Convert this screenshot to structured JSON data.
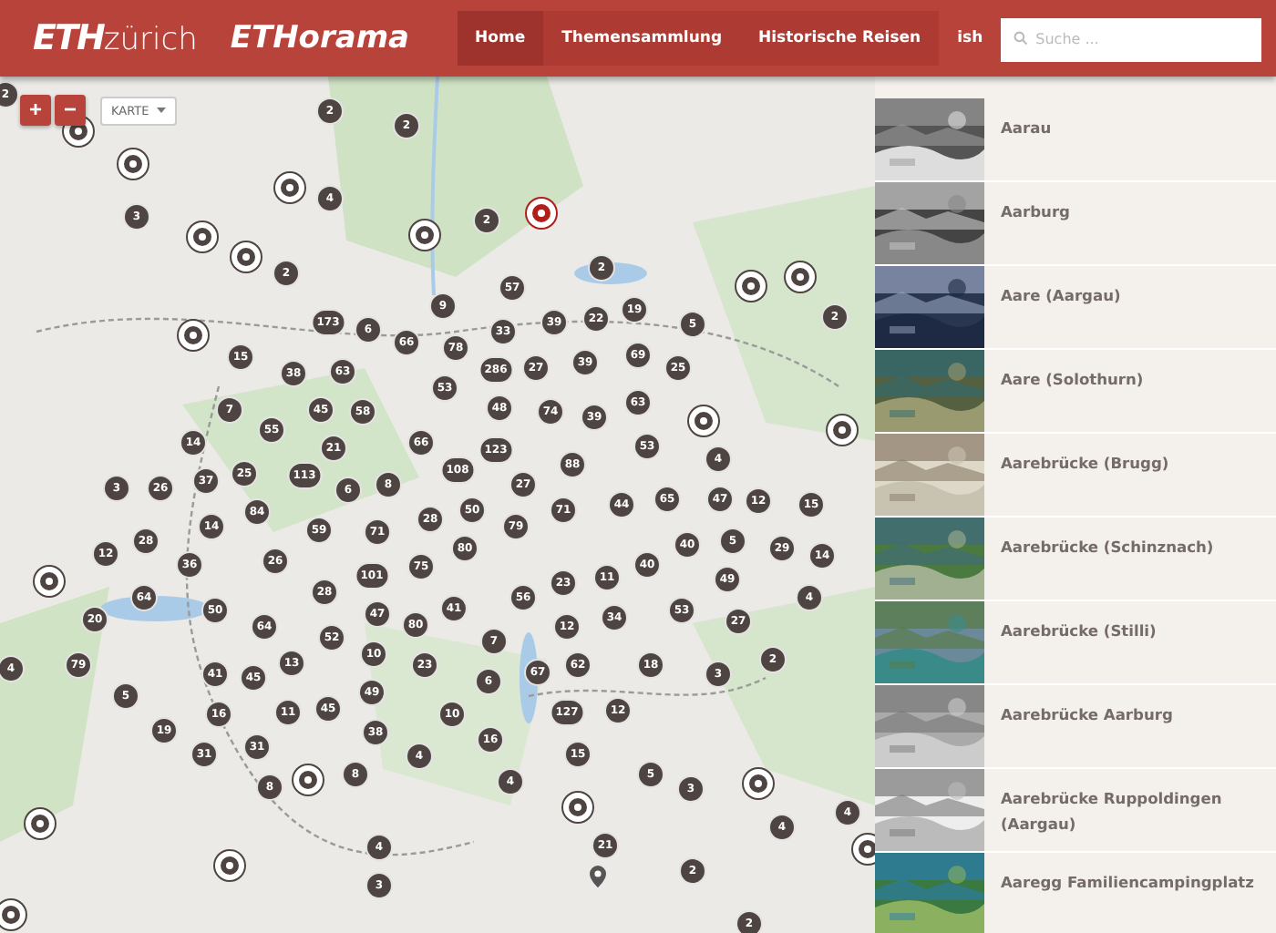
{
  "header": {
    "logo": {
      "brand": "ETH",
      "name": "zürich"
    },
    "app_name": "ETHorama",
    "nav": [
      {
        "label": "Home",
        "selected": true
      },
      {
        "label": "Themensammlung",
        "selected": false
      },
      {
        "label": "Historische Reisen",
        "selected": false
      },
      {
        "label": "ish",
        "selected": false
      }
    ],
    "search": {
      "placeholder": "Suche ..."
    }
  },
  "map": {
    "zoom_in": "+",
    "zoom_out": "−",
    "layer_select": "KARTE",
    "markers": [
      {
        "kind": "cluster",
        "count": "2"
      },
      {
        "kind": "cluster",
        "count": "2"
      },
      {
        "kind": "single",
        "selected": false
      },
      {
        "kind": "cluster",
        "count": "2"
      },
      {
        "kind": "single",
        "selected": false
      },
      {
        "kind": "single",
        "selected": false
      },
      {
        "kind": "cluster",
        "count": "4"
      },
      {
        "kind": "cluster",
        "count": "3"
      },
      {
        "kind": "cluster",
        "count": "2"
      },
      {
        "kind": "single",
        "selected": true
      },
      {
        "kind": "single",
        "selected": false
      },
      {
        "kind": "single",
        "selected": false
      },
      {
        "kind": "single",
        "selected": false
      },
      {
        "kind": "cluster",
        "count": "2"
      },
      {
        "kind": "cluster",
        "count": "57"
      },
      {
        "kind": "cluster",
        "count": "2"
      },
      {
        "kind": "single",
        "selected": false
      },
      {
        "kind": "single",
        "selected": false
      },
      {
        "kind": "single",
        "selected": false
      },
      {
        "kind": "cluster",
        "count": "173"
      },
      {
        "kind": "cluster",
        "count": "6"
      },
      {
        "kind": "cluster",
        "count": "9"
      },
      {
        "kind": "cluster",
        "count": "33"
      },
      {
        "kind": "cluster",
        "count": "39"
      },
      {
        "kind": "cluster",
        "count": "22"
      },
      {
        "kind": "cluster",
        "count": "19"
      },
      {
        "kind": "cluster",
        "count": "5"
      },
      {
        "kind": "cluster",
        "count": "2"
      },
      {
        "kind": "cluster",
        "count": "15"
      },
      {
        "kind": "cluster",
        "count": "66"
      },
      {
        "kind": "cluster",
        "count": "78"
      },
      {
        "kind": "cluster",
        "count": "69"
      },
      {
        "kind": "cluster",
        "count": "38"
      },
      {
        "kind": "cluster",
        "count": "63"
      },
      {
        "kind": "cluster",
        "count": "286"
      },
      {
        "kind": "cluster",
        "count": "27"
      },
      {
        "kind": "cluster",
        "count": "39"
      },
      {
        "kind": "cluster",
        "count": "25"
      },
      {
        "kind": "cluster",
        "count": "53"
      },
      {
        "kind": "cluster",
        "count": "7"
      },
      {
        "kind": "cluster",
        "count": "55"
      },
      {
        "kind": "cluster",
        "count": "45"
      },
      {
        "kind": "cluster",
        "count": "58"
      },
      {
        "kind": "cluster",
        "count": "48"
      },
      {
        "kind": "cluster",
        "count": "74"
      },
      {
        "kind": "cluster",
        "count": "39"
      },
      {
        "kind": "cluster",
        "count": "63"
      },
      {
        "kind": "single",
        "selected": false
      },
      {
        "kind": "cluster",
        "count": "14"
      },
      {
        "kind": "cluster",
        "count": "21"
      },
      {
        "kind": "cluster",
        "count": "66"
      },
      {
        "kind": "cluster",
        "count": "123"
      },
      {
        "kind": "cluster",
        "count": "53"
      },
      {
        "kind": "single",
        "selected": false
      },
      {
        "kind": "cluster",
        "count": "3"
      },
      {
        "kind": "cluster",
        "count": "26"
      },
      {
        "kind": "cluster",
        "count": "37"
      },
      {
        "kind": "cluster",
        "count": "25"
      },
      {
        "kind": "cluster",
        "count": "113"
      },
      {
        "kind": "cluster",
        "count": "6"
      },
      {
        "kind": "cluster",
        "count": "8"
      },
      {
        "kind": "cluster",
        "count": "108"
      },
      {
        "kind": "cluster",
        "count": "27"
      },
      {
        "kind": "cluster",
        "count": "88"
      },
      {
        "kind": "cluster",
        "count": "4"
      },
      {
        "kind": "cluster",
        "count": "84"
      },
      {
        "kind": "cluster",
        "count": "50"
      },
      {
        "kind": "cluster",
        "count": "71"
      },
      {
        "kind": "cluster",
        "count": "44"
      },
      {
        "kind": "cluster",
        "count": "65"
      },
      {
        "kind": "cluster",
        "count": "47"
      },
      {
        "kind": "cluster",
        "count": "12"
      },
      {
        "kind": "cluster",
        "count": "15"
      },
      {
        "kind": "cluster",
        "count": "14"
      },
      {
        "kind": "cluster",
        "count": "59"
      },
      {
        "kind": "cluster",
        "count": "71"
      },
      {
        "kind": "cluster",
        "count": "28"
      },
      {
        "kind": "cluster",
        "count": "79"
      },
      {
        "kind": "cluster",
        "count": "12"
      },
      {
        "kind": "cluster",
        "count": "28"
      },
      {
        "kind": "cluster",
        "count": "36"
      },
      {
        "kind": "cluster",
        "count": "26"
      },
      {
        "kind": "cluster",
        "count": "75"
      },
      {
        "kind": "cluster",
        "count": "80"
      },
      {
        "kind": "cluster",
        "count": "40"
      },
      {
        "kind": "cluster",
        "count": "40"
      },
      {
        "kind": "cluster",
        "count": "5"
      },
      {
        "kind": "cluster",
        "count": "29"
      },
      {
        "kind": "cluster",
        "count": "14"
      },
      {
        "kind": "single",
        "selected": false
      },
      {
        "kind": "cluster",
        "count": "101"
      },
      {
        "kind": "cluster",
        "count": "23"
      },
      {
        "kind": "cluster",
        "count": "11"
      },
      {
        "kind": "cluster",
        "count": "49"
      },
      {
        "kind": "cluster",
        "count": "64"
      },
      {
        "kind": "cluster",
        "count": "28"
      },
      {
        "kind": "cluster",
        "count": "56"
      },
      {
        "kind": "cluster",
        "count": "4"
      },
      {
        "kind": "cluster",
        "count": "20"
      },
      {
        "kind": "cluster",
        "count": "50"
      },
      {
        "kind": "cluster",
        "count": "64"
      },
      {
        "kind": "cluster",
        "count": "47"
      },
      {
        "kind": "cluster",
        "count": "80"
      },
      {
        "kind": "cluster",
        "count": "41"
      },
      {
        "kind": "cluster",
        "count": "12"
      },
      {
        "kind": "cluster",
        "count": "34"
      },
      {
        "kind": "cluster",
        "count": "53"
      },
      {
        "kind": "cluster",
        "count": "27"
      },
      {
        "kind": "cluster",
        "count": "52"
      },
      {
        "kind": "cluster",
        "count": "7"
      },
      {
        "kind": "cluster",
        "count": "4"
      },
      {
        "kind": "cluster",
        "count": "79"
      },
      {
        "kind": "cluster",
        "count": "41"
      },
      {
        "kind": "cluster",
        "count": "45"
      },
      {
        "kind": "cluster",
        "count": "13"
      },
      {
        "kind": "cluster",
        "count": "10"
      },
      {
        "kind": "cluster",
        "count": "23"
      },
      {
        "kind": "cluster",
        "count": "6"
      },
      {
        "kind": "cluster",
        "count": "67"
      },
      {
        "kind": "cluster",
        "count": "62"
      },
      {
        "kind": "cluster",
        "count": "18"
      },
      {
        "kind": "cluster",
        "count": "3"
      },
      {
        "kind": "cluster",
        "count": "2"
      },
      {
        "kind": "cluster",
        "count": "5"
      },
      {
        "kind": "cluster",
        "count": "49"
      },
      {
        "kind": "cluster",
        "count": "16"
      },
      {
        "kind": "cluster",
        "count": "11"
      },
      {
        "kind": "cluster",
        "count": "45"
      },
      {
        "kind": "cluster",
        "count": "10"
      },
      {
        "kind": "cluster",
        "count": "127"
      },
      {
        "kind": "cluster",
        "count": "12"
      },
      {
        "kind": "cluster",
        "count": "19"
      },
      {
        "kind": "cluster",
        "count": "38"
      },
      {
        "kind": "cluster",
        "count": "16"
      },
      {
        "kind": "cluster",
        "count": "31"
      },
      {
        "kind": "cluster",
        "count": "31"
      },
      {
        "kind": "cluster",
        "count": "4"
      },
      {
        "kind": "cluster",
        "count": "15"
      },
      {
        "kind": "cluster",
        "count": "8"
      },
      {
        "kind": "single",
        "selected": false
      },
      {
        "kind": "cluster",
        "count": "8"
      },
      {
        "kind": "cluster",
        "count": "4"
      },
      {
        "kind": "cluster",
        "count": "5"
      },
      {
        "kind": "cluster",
        "count": "3"
      },
      {
        "kind": "single",
        "selected": false
      },
      {
        "kind": "single",
        "selected": false
      },
      {
        "kind": "single",
        "selected": false
      },
      {
        "kind": "cluster",
        "count": "4"
      },
      {
        "kind": "cluster",
        "count": "4"
      },
      {
        "kind": "cluster",
        "count": "4"
      },
      {
        "kind": "cluster",
        "count": "21"
      },
      {
        "kind": "single",
        "selected": false
      },
      {
        "kind": "single",
        "selected": false
      },
      {
        "kind": "cluster",
        "count": "2"
      },
      {
        "kind": "cluster",
        "count": "3"
      },
      {
        "kind": "pin"
      },
      {
        "kind": "single",
        "selected": false
      },
      {
        "kind": "cluster",
        "count": "2"
      }
    ]
  },
  "places": [
    {
      "title": "Aarau"
    },
    {
      "title": "Aarburg"
    },
    {
      "title": "Aare (Aargau)"
    },
    {
      "title": "Aare (Solothurn)"
    },
    {
      "title": "Aarebrücke (Brugg)"
    },
    {
      "title": "Aarebrücke (Schinznach)"
    },
    {
      "title": "Aarebrücke (Stilli)"
    },
    {
      "title": "Aarebrücke Aarburg"
    },
    {
      "title": "Aarebrücke Ruppoldingen (Aargau)"
    },
    {
      "title": "Aaregg Familiencampingplatz"
    }
  ]
}
